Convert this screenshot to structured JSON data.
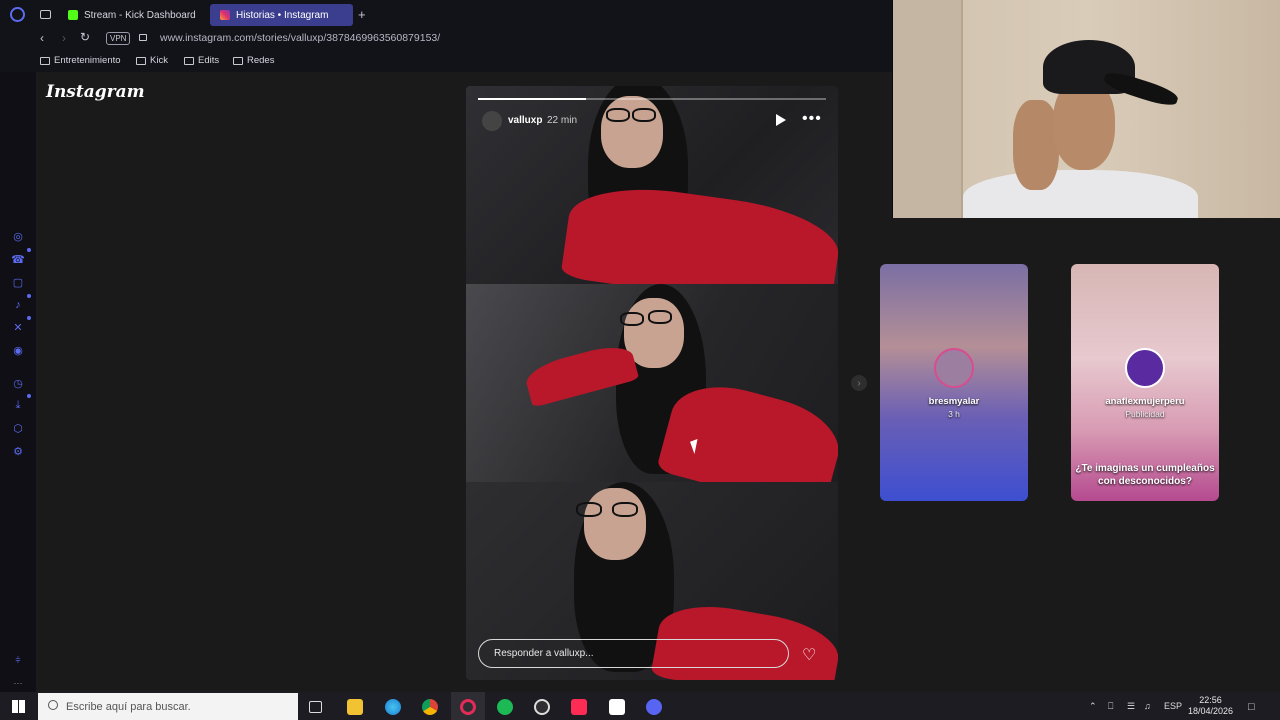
{
  "browser": {
    "tabs": [
      {
        "label": "Stream - Kick Dashboard",
        "favicon_color": "#53fc18",
        "active": false
      },
      {
        "label": "Historias • Instagram",
        "favicon_color": "#e1306c",
        "active": true
      }
    ],
    "new_tab": "+",
    "vpn_label": "VPN",
    "url": "www.instagram.com/stories/valluxp/3878469963560879153/",
    "bookmarks": [
      "Entretenimiento",
      "Kick",
      "Edits",
      "Redes"
    ]
  },
  "sidebar_icons": [
    "opera-icon",
    "whatsapp-icon",
    "instagram-icon",
    "tiktok-icon",
    "x-icon",
    "discord-icon",
    "history-icon",
    "download-icon",
    "extensions-icon",
    "settings-icon"
  ],
  "instagram": {
    "logo": "Instagram",
    "story": {
      "username": "valluxp",
      "time": "22 min",
      "progress": 0.31,
      "reply_placeholder": "Responder a valluxp..."
    },
    "previews": [
      {
        "username": "bresmyalar",
        "sub": "3 h",
        "caption": ""
      },
      {
        "username": "anaflexmujerperu",
        "sub": "Publicidad",
        "caption_line1": "¿Te imaginas un cumpleaños",
        "caption_line2": "con desconocidos?"
      }
    ]
  },
  "taskbar": {
    "search_placeholder": "Escribe aquí para buscar.",
    "language": "ESP",
    "time": "22:56",
    "date": "18/04/2026"
  },
  "colors": {
    "accent": "#5b6cf0",
    "active_tab": "#3b3d8e",
    "page_bg": "#1a1a1a"
  }
}
